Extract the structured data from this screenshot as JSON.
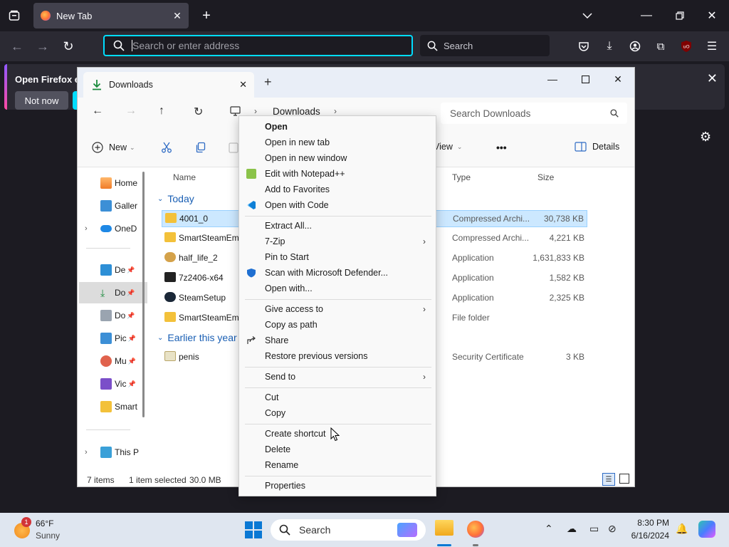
{
  "firefox": {
    "tab_title": "New Tab",
    "url_placeholder": "Search or enter address",
    "search_label": "Search",
    "notification_text": "Open Firefox ev",
    "not_now_label": "Not now",
    "ublock_label": "uO"
  },
  "explorer": {
    "tab_title": "Downloads",
    "breadcrumb": "Downloads",
    "search_placeholder": "Search Downloads",
    "commands": {
      "new_label": "New",
      "view_label": "View",
      "more_label": "•••",
      "details_label": "Details"
    },
    "columns": {
      "name": "Name",
      "type": "Type",
      "size": "Size"
    },
    "nav": [
      {
        "label": "Home",
        "icon": "home-icon"
      },
      {
        "label": "Galler",
        "icon": "gallery-icon"
      },
      {
        "label": "OneD",
        "icon": "onedrive-icon"
      },
      {
        "label": "De",
        "icon": "desktop-icon"
      },
      {
        "label": "Do",
        "icon": "downloads-icon"
      },
      {
        "label": "Do",
        "icon": "documents-icon"
      },
      {
        "label": "Pic",
        "icon": "pictures-icon"
      },
      {
        "label": "Mu",
        "icon": "music-icon"
      },
      {
        "label": "Vic",
        "icon": "videos-icon"
      },
      {
        "label": "Smart",
        "icon": "folder-icon"
      },
      {
        "label": "This P",
        "icon": "this-pc-icon"
      }
    ],
    "groups": {
      "today": "Today",
      "earlier": "Earlier this year"
    },
    "files": [
      {
        "name": "4001_0",
        "type": "Compressed Archi...",
        "size": "30,738 KB"
      },
      {
        "name": "SmartSteamEmu",
        "type": "Compressed Archi...",
        "size": "4,221 KB"
      },
      {
        "name": "half_life_2",
        "type": "Application",
        "size": "1,631,833 KB"
      },
      {
        "name": "7z2406-x64",
        "type": "Application",
        "size": "1,582 KB"
      },
      {
        "name": "SteamSetup",
        "type": "Application",
        "size": "2,325 KB"
      },
      {
        "name": "SmartSteamEmu",
        "type": "File folder",
        "size": ""
      },
      {
        "name": "penis",
        "type": "Security Certificate",
        "size": "3 KB"
      }
    ],
    "status": {
      "items": "7 items",
      "selected": "1 item selected",
      "selected_size": "30.0 MB"
    }
  },
  "context_menu": {
    "open": "Open",
    "open_new_tab": "Open in new tab",
    "open_new_window": "Open in new window",
    "edit_notepad": "Edit with Notepad++",
    "add_favorites": "Add to Favorites",
    "open_code": "Open with Code",
    "extract_all": "Extract All...",
    "seven_zip": "7-Zip",
    "pin_start": "Pin to Start",
    "scan_defender": "Scan with Microsoft Defender...",
    "open_with": "Open with...",
    "give_access": "Give access to",
    "copy_path": "Copy as path",
    "share": "Share",
    "restore_versions": "Restore previous versions",
    "send_to": "Send to",
    "cut": "Cut",
    "copy": "Copy",
    "create_shortcut": "Create shortcut",
    "delete": "Delete",
    "rename": "Rename",
    "properties": "Properties"
  },
  "taskbar": {
    "weather_temp": "66°F",
    "weather_desc": "Sunny",
    "weather_badge": "1",
    "search_label": "Search",
    "time": "8:30 PM",
    "date": "6/16/2024"
  }
}
